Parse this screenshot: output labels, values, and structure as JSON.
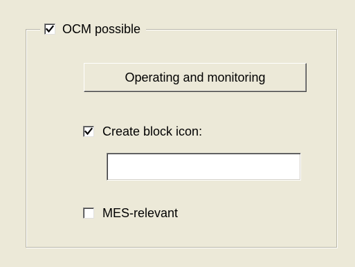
{
  "group": {
    "title": "OCM possible",
    "checked": true
  },
  "operating_button": {
    "label": "Operating and monitoring"
  },
  "create_block_icon": {
    "label": "Create block icon:",
    "checked": true,
    "value": ""
  },
  "mes_relevant": {
    "label": "MES-relevant",
    "checked": false
  },
  "icons": {
    "check": "check-mark-icon"
  }
}
